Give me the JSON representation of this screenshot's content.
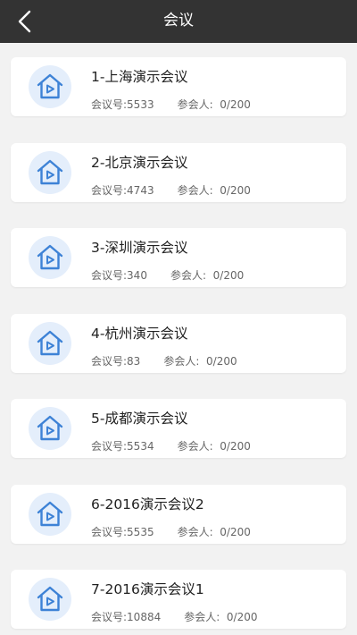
{
  "header": {
    "title": "会议"
  },
  "meetings": [
    {
      "title": "1-上海演示会议",
      "number_label": "会议号:5533",
      "participants_label": "参会人:",
      "participants_value": "0/200"
    },
    {
      "title": "2-北京演示会议",
      "number_label": "会议号:4743",
      "participants_label": "参会人:",
      "participants_value": "0/200"
    },
    {
      "title": "3-深圳演示会议",
      "number_label": "会议号:340",
      "participants_label": "参会人:",
      "participants_value": "0/200"
    },
    {
      "title": "4-杭州演示会议",
      "number_label": "会议号:83",
      "participants_label": "参会人:",
      "participants_value": "0/200"
    },
    {
      "title": "5-成都演示会议",
      "number_label": "会议号:5534",
      "participants_label": "参会人:",
      "participants_value": "0/200"
    },
    {
      "title": "6-2016演示会议2",
      "number_label": "会议号:5535",
      "participants_label": "参会人:",
      "participants_value": "0/200"
    },
    {
      "title": "7-2016演示会议1",
      "number_label": "会议号:10884",
      "participants_label": "参会人:",
      "participants_value": "0/200"
    }
  ],
  "icons": {
    "back": "chevron-left-icon",
    "meeting": "house-play-icon"
  },
  "colors": {
    "header_bg": "#333333",
    "icon_blue": "#3d82d6",
    "icon_circle": "#e4eefb",
    "page_bg": "#f2f2f2"
  }
}
